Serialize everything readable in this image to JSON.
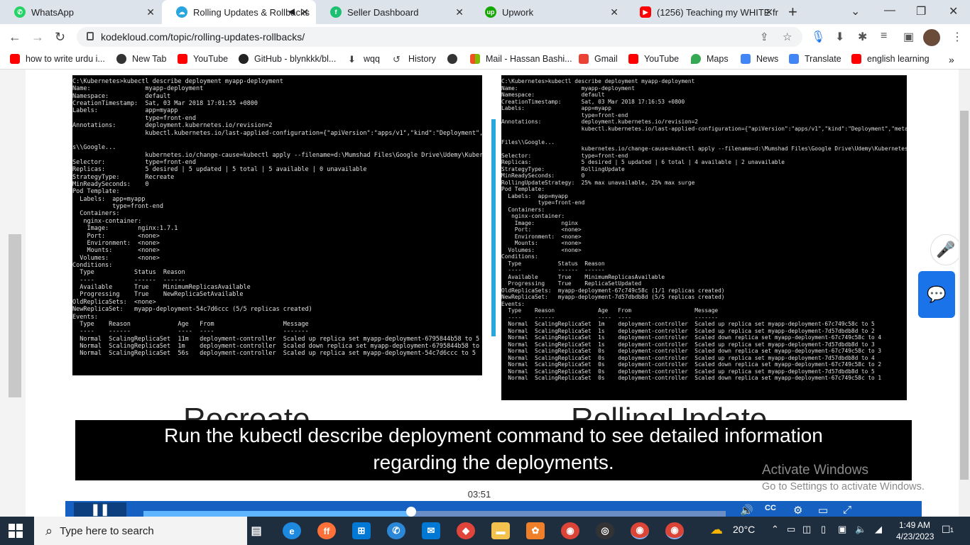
{
  "browser": {
    "tabs": [
      {
        "title": "WhatsApp",
        "icon": "whatsapp-icon",
        "color": "#25d366"
      },
      {
        "title": "Rolling Updates & Rollbacks",
        "icon": "kodekloud-icon",
        "color": "#29a5e0",
        "active": true
      },
      {
        "title": "Seller Dashboard",
        "icon": "fiverr-icon",
        "color": "#1dbf73"
      },
      {
        "title": "Upwork",
        "icon": "upwork-icon",
        "color": "#14a800"
      },
      {
        "title": "(1256) Teaching my WHITE fr",
        "icon": "youtube-icon",
        "color": "#ff0000"
      }
    ],
    "url": "kodekloud.com/topic/rolling-updates-rollbacks/",
    "bookmarks": [
      {
        "label": "how to write urdu i...",
        "icon": "youtube-icon",
        "color": "#ff0000"
      },
      {
        "label": "New Tab",
        "icon": "globe-icon",
        "color": "#333333"
      },
      {
        "label": "YouTube",
        "icon": "youtube-icon",
        "color": "#ff0000"
      },
      {
        "label": "GitHub - blynkkk/bl...",
        "icon": "github-icon",
        "color": "#222222"
      },
      {
        "label": "wqq",
        "icon": "download-icon",
        "color": "#444444"
      },
      {
        "label": "History",
        "icon": "history-icon",
        "color": "#444444"
      },
      {
        "label": "",
        "icon": "globe-icon",
        "color": "#333333"
      },
      {
        "label": "Mail - Hassan Bashi...",
        "icon": "microsoft-icon",
        "color": "#f25022"
      },
      {
        "label": "Gmail",
        "icon": "gmail-icon",
        "color": "#ea4335"
      },
      {
        "label": "YouTube",
        "icon": "youtube-icon",
        "color": "#ff0000"
      },
      {
        "label": "Maps",
        "icon": "maps-icon",
        "color": "#34a853"
      },
      {
        "label": "News",
        "icon": "news-icon",
        "color": "#4285f4"
      },
      {
        "label": "Translate",
        "icon": "translate-icon",
        "color": "#4285f4"
      },
      {
        "label": "english learning",
        "icon": "youtube-icon",
        "color": "#ff0000"
      }
    ]
  },
  "slide": {
    "terminal_left": "C:\\Kubernetes>kubectl describe deployment myapp-deployment\nName:               myapp-deployment\nNamespace:          default\nCreationTimestamp:  Sat, 03 Mar 2018 17:01:55 +0800\nLabels:             app=myapp\n                    type=front-end\nAnnotations:        deployment.kubernetes.io/revision=2\n                    kubectl.kubernetes.io/last-applied-configuration={\"apiVersion\":\"apps/v1\",\"kind\":\"Deployment\",\"me\n\ns\\\\Google...\n                    kubernetes.io/change-cause=kubectl apply --filename=d:\\Mumshad Files\\Google Drive\\Udemy\\Kubernet\nSelector:           type=front-end\nReplicas:           5 desired | 5 updated | 5 total | 5 available | 0 unavailable\nStrategyType:       Recreate\nMinReadySeconds:    0\nPod Template:\n  Labels:  app=myapp\n           type=front-end\n  Containers:\n   nginx-container:\n    Image:        nginx:1.7.1\n    Port:         <none>\n    Environment:  <none>\n    Mounts:       <none>\n  Volumes:        <none>\nConditions:\n  Type           Status  Reason\n  ----           ------  ------\n  Available      True    MinimumReplicasAvailable\n  Progressing    True    NewReplicaSetAvailable\nOldReplicaSets:  <none>\nNewReplicaSet:   myapp-deployment-54c7d6ccc (5/5 replicas created)\nEvents:\n  Type    Reason             Age   From                   Message\n  ----    ------             ----  ----                   -------\n  Normal  ScalingReplicaSet  11m   deployment-controller  Scaled up replica set myapp-deployment-6795844b58 to 5\n  Normal  ScalingReplicaSet  1m    deployment-controller  Scaled down replica set myapp-deployment-6795844b58 to 0\n  Normal  ScalingReplicaSet  56s   deployment-controller  Scaled up replica set myapp-deployment-54c7d6ccc to 5",
    "terminal_right": "C:\\Kubernetes>kubectl describe deployment myapp-deployment\nName:                   myapp-deployment\nNamespace:              default\nCreationTimestamp:      Sat, 03 Mar 2018 17:16:53 +0800\nLabels:                 app=myapp\n                        type=front-end\nAnnotations:            deployment.kubernetes.io/revision=2\n                        kubectl.kubernetes.io/last-applied-configuration={\"apiVersion\":\"apps/v1\",\"kind\":\"Deployment\",\"metadata\n\nFiles\\\\Google...\n                        kubernetes.io/change-cause=kubectl apply --filename=d:\\Mumshad Files\\Google Drive\\Udemy\\Kubernetes\\De\nSelector:               type=front-end\nReplicas:               5 desired | 5 updated | 6 total | 4 available | 2 unavailable\nStrategyType:           RollingUpdate\nMinReadySeconds:        0\nRollingUpdateStrategy:  25% max unavailable, 25% max surge\nPod Template:\n  Labels:  app=myapp\n           type=front-end\n  Containers:\n   nginx-container:\n    Image:        nginx\n    Port:         <none>\n    Environment:  <none>\n    Mounts:       <none>\n  Volumes:        <none>\nConditions:\n  Type           Status  Reason\n  ----           ------  ------\n  Available      True    MinimumReplicasAvailable\n  Progressing    True    ReplicaSetUpdated\nOldReplicaSets:  myapp-deployment-67c749c58c (1/1 replicas created)\nNewReplicaSet:   myapp-deployment-7d57dbdb8d (5/5 replicas created)\nEvents:\n  Type    Reason             Age   From                   Message\n  ----    ------             ----  ----                   -------\n  Normal  ScalingReplicaSet  1m    deployment-controller  Scaled up replica set myapp-deployment-67c749c58c to 5\n  Normal  ScalingReplicaSet  1s    deployment-controller  Scaled up replica set myapp-deployment-7d57dbdb8d to 2\n  Normal  ScalingReplicaSet  1s    deployment-controller  Scaled down replica set myapp-deployment-67c749c58c to 4\n  Normal  ScalingReplicaSet  1s    deployment-controller  Scaled up replica set myapp-deployment-7d57dbdb8d to 3\n  Normal  ScalingReplicaSet  0s    deployment-controller  Scaled down replica set myapp-deployment-67c749c58c to 3\n  Normal  ScalingReplicaSet  0s    deployment-controller  Scaled up replica set myapp-deployment-7d57dbdb8d to 4\n  Normal  ScalingReplicaSet  0s    deployment-controller  Scaled down replica set myapp-deployment-67c749c58c to 2\n  Normal  ScalingReplicaSet  0s    deployment-controller  Scaled up replica set myapp-deployment-7d57dbdb8d to 5\n  Normal  ScalingReplicaSet  0s    deployment-controller  Scaled down replica set myapp-deployment-67c749c58c to 1",
    "label_left": "Recreate",
    "label_right": "RollingUpdate",
    "caption_line1": "Run the kubectl describe deployment command to see detailed information",
    "caption_line2": "regarding the deployments."
  },
  "player": {
    "time_tooltip": "03:51",
    "progress": 0.46
  },
  "windows_activation": {
    "title": "Activate Windows",
    "subtitle": "Go to Settings to activate Windows."
  },
  "taskbar": {
    "search_placeholder": "Type here to search",
    "weather": "20°C",
    "time": "1:49 AM",
    "date": "4/23/2023",
    "notifications": "1"
  }
}
